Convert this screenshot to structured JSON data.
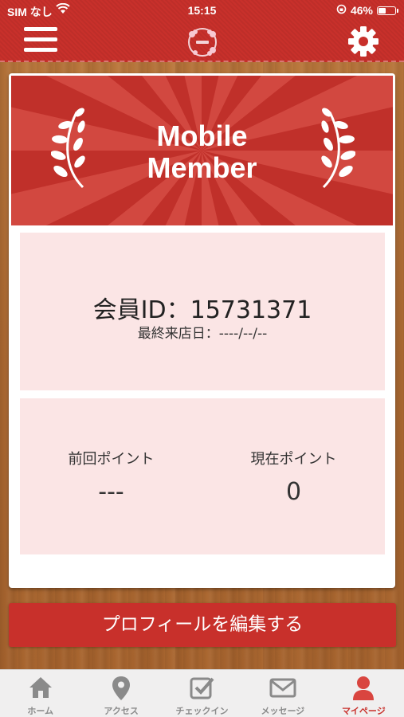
{
  "status_bar": {
    "carrier": "SIM なし",
    "time": "15:15",
    "battery": "46%",
    "battery_level": 0.46
  },
  "header": {
    "menu_icon": "hamburger-icon",
    "settings_icon": "gear-icon"
  },
  "banner": {
    "title_line1": "Mobile",
    "title_line2": "Member"
  },
  "member": {
    "id_text": "会員ID：15731371",
    "last_visit": "最終来店日：----/--/--"
  },
  "points": {
    "previous_label": "前回ポイント",
    "previous_value": "---",
    "current_label": "現在ポイント",
    "current_value": "0"
  },
  "edit_profile_label": "プロフィールを編集する",
  "tabs": [
    {
      "label": "ホーム",
      "icon": "home-icon",
      "active": false
    },
    {
      "label": "アクセス",
      "icon": "map-pin-icon",
      "active": false
    },
    {
      "label": "チェックイン",
      "icon": "checkin-icon",
      "active": false
    },
    {
      "label": "メッセージ",
      "icon": "mail-icon",
      "active": false
    },
    {
      "label": "マイページ",
      "icon": "user-icon",
      "active": true
    }
  ],
  "colors": {
    "accent": "#c8302b",
    "panel": "#fbe5e5",
    "tab_inactive": "#8a8a8a"
  }
}
